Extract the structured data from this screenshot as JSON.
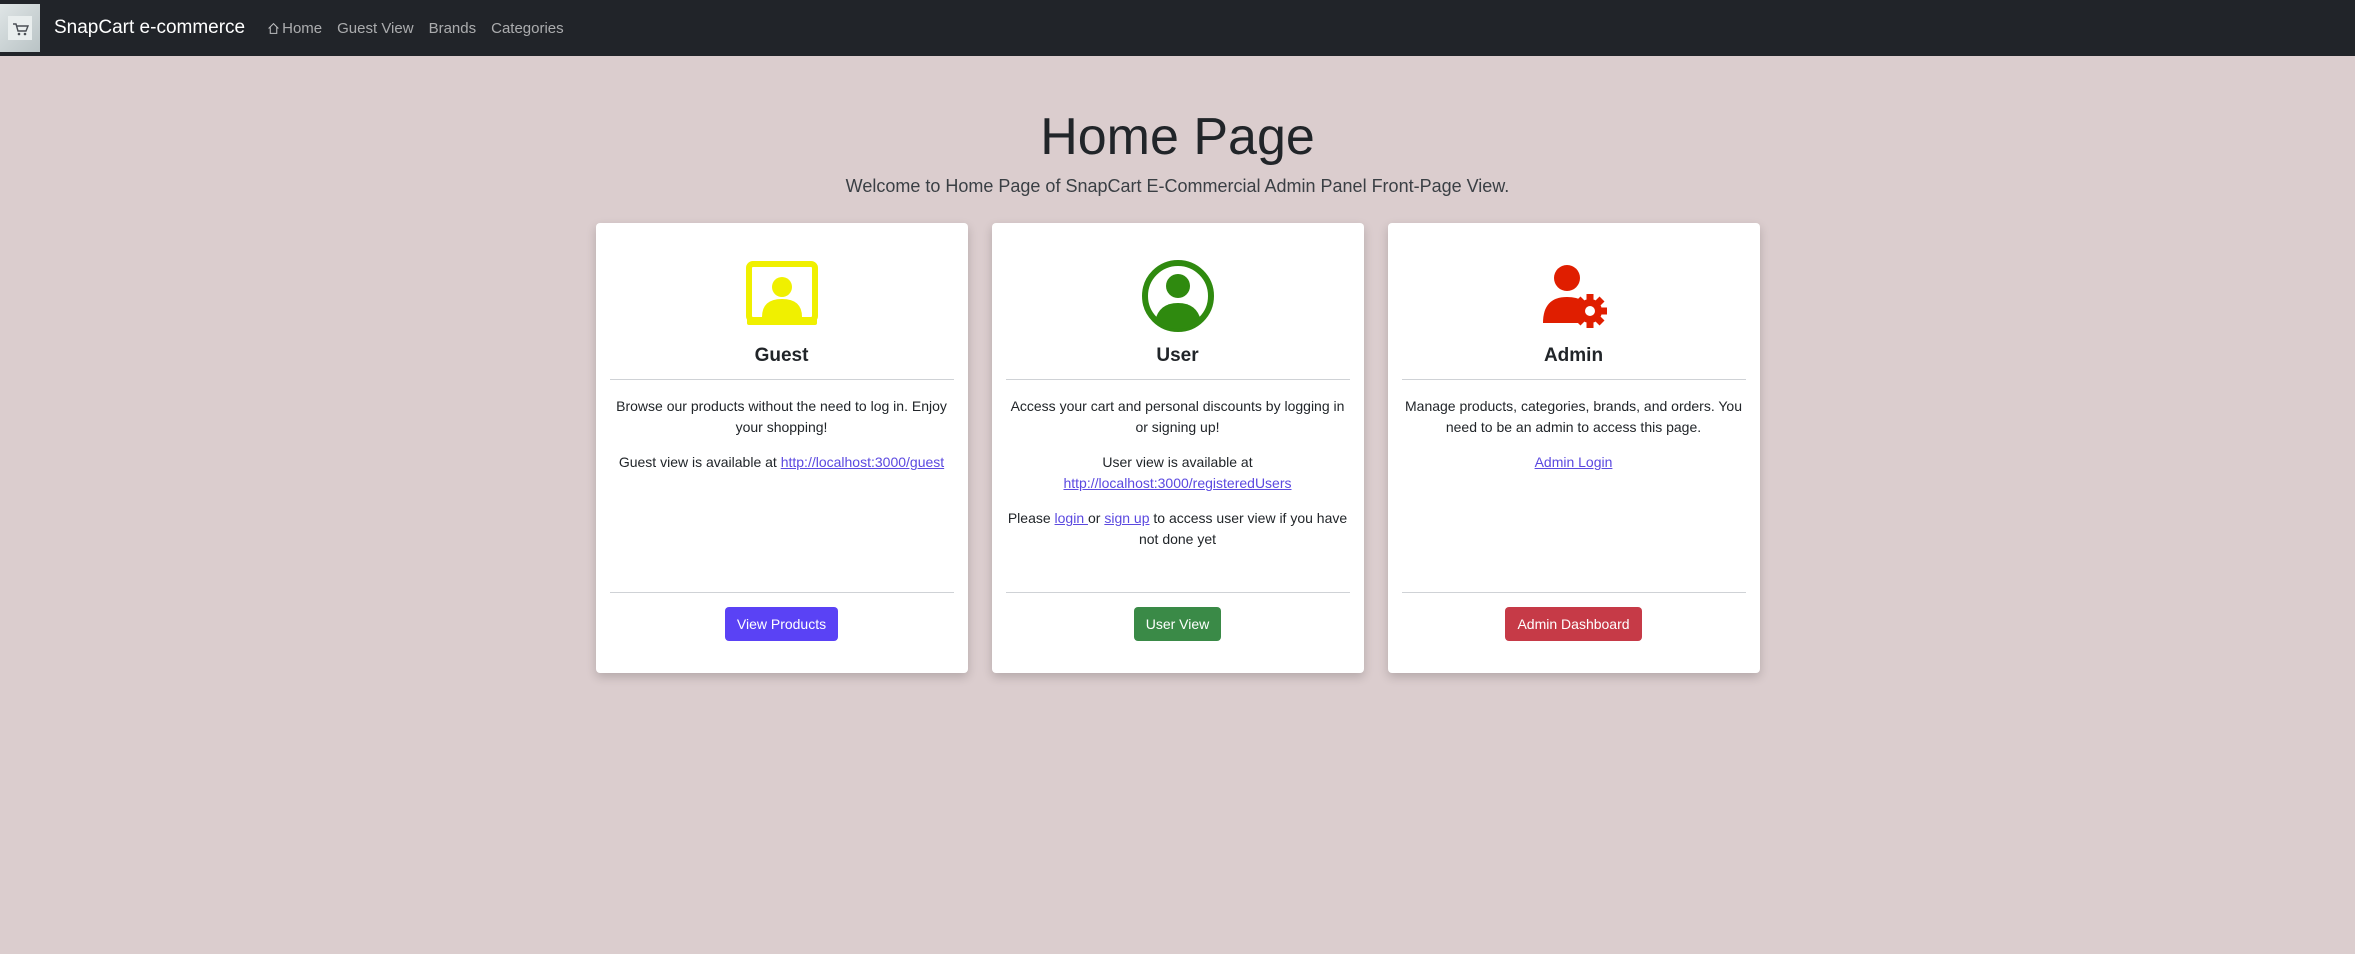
{
  "navbar": {
    "brand": "SnapCart e-commerce",
    "links": [
      "Home",
      "Guest View",
      "Brands",
      "Categories"
    ],
    "icons": [
      "snapcart-logo-icon",
      "home-icon"
    ]
  },
  "main": {
    "title": "Home Page",
    "subtitle": "Welcome to Home Page of SnapCart E-Commercial Admin Panel Front-Page View."
  },
  "cards": {
    "guest": {
      "title": "Guest",
      "icon": "guest-monitor-icon",
      "color": "#f0f000",
      "description": "Browse our products without the need to log in. Enjoy your shopping!",
      "availability_prefix": "Guest view is available at ",
      "url": "http://localhost:3000/guest",
      "button": "View Products",
      "button_color": "#5a42f5"
    },
    "user": {
      "title": "User",
      "icon": "user-circle-icon",
      "color": "#2f8a0f",
      "description": "Access your cart and personal discounts by logging in or signing up!",
      "availability_prefix": "User view is available at ",
      "url": "http://localhost:3000/registeredUsers",
      "please": "Please ",
      "login": "login ",
      "or": "or ",
      "signup": "sign up",
      "suffix": " to access user view if you have not done yet",
      "button": "User View",
      "button_color": "#3a8a47"
    },
    "admin": {
      "title": "Admin",
      "icon": "admin-gear-icon",
      "color": "#e01e00",
      "description": "Manage products, categories, brands, and orders. You need to be an admin to access this page.",
      "link": "Admin Login",
      "button": "Admin Dashboard",
      "button_color": "#c63a47"
    }
  }
}
